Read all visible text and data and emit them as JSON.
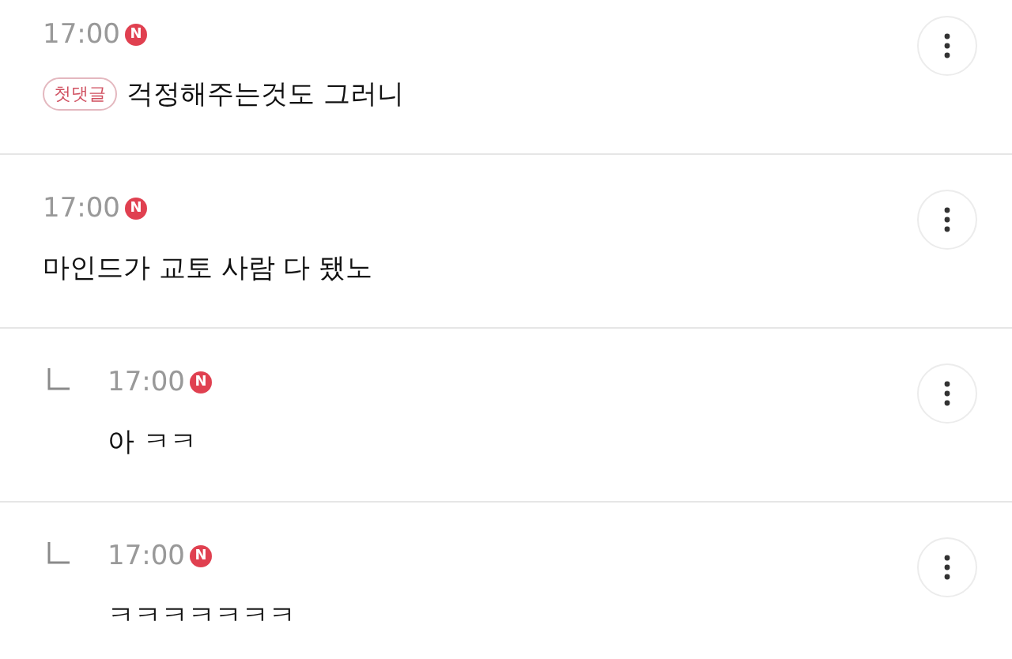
{
  "comments": [
    {
      "reply": false,
      "time": "17:00",
      "new_badge": "N",
      "tag": "첫댓글",
      "text": "걱정해주는것도 그러니"
    },
    {
      "reply": false,
      "time": "17:00",
      "new_badge": "N",
      "text": "마인드가 교토 사람 다 됐노"
    },
    {
      "reply": true,
      "time": "17:00",
      "new_badge": "N",
      "text": "아 ㅋㅋ"
    },
    {
      "reply": true,
      "time": "17:00",
      "new_badge": "N",
      "text": "ㅋㅋㅋㅋㅋㅋㅋ"
    }
  ]
}
